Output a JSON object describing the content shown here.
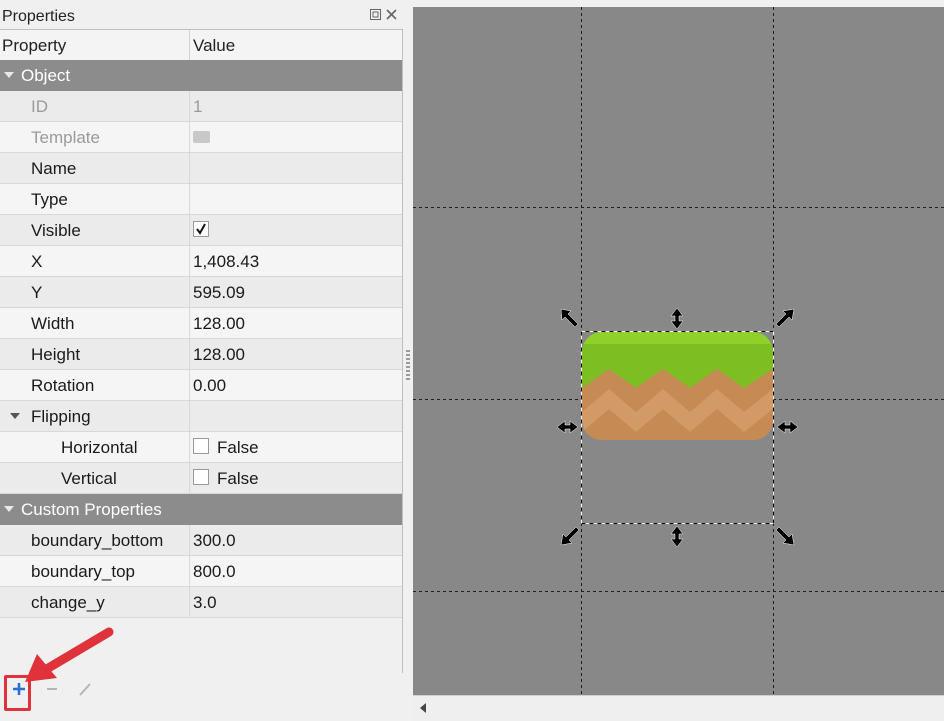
{
  "panel": {
    "title": "Properties"
  },
  "table": {
    "col_property": "Property",
    "col_value": "Value"
  },
  "groups": {
    "object": "Object",
    "custom": "Custom Properties"
  },
  "props": {
    "id": {
      "label": "ID",
      "value": "1"
    },
    "template": {
      "label": "Template"
    },
    "name": {
      "label": "Name",
      "value": ""
    },
    "type": {
      "label": "Type",
      "value": ""
    },
    "visible": {
      "label": "Visible",
      "checked": true
    },
    "x": {
      "label": "X",
      "value": "1,408.43"
    },
    "y": {
      "label": "Y",
      "value": "595.09"
    },
    "width": {
      "label": "Width",
      "value": "128.00"
    },
    "height": {
      "label": "Height",
      "value": "128.00"
    },
    "rotation": {
      "label": "Rotation",
      "value": "0.00"
    },
    "flipping": {
      "label": "Flipping"
    },
    "horizontal": {
      "label": "Horizontal",
      "value": "False"
    },
    "vertical": {
      "label": "Vertical",
      "value": "False"
    }
  },
  "custom": {
    "boundary_bottom": {
      "label": "boundary_bottom",
      "value": "300.0"
    },
    "boundary_top": {
      "label": "boundary_top",
      "value": "800.0"
    },
    "change_y": {
      "label": "change_y",
      "value": "3.0"
    }
  },
  "toolbar": {
    "add_icon": "plus-icon",
    "remove_icon": "minus-icon",
    "rename_icon": "pencil-icon"
  },
  "colors": {
    "canvas": "#888888",
    "group_header": "#8c8c8c",
    "highlight": "#e0323a",
    "grass": "#7dbf22",
    "dirt": "#c68a55",
    "add_icon": "#2a6fd6"
  }
}
